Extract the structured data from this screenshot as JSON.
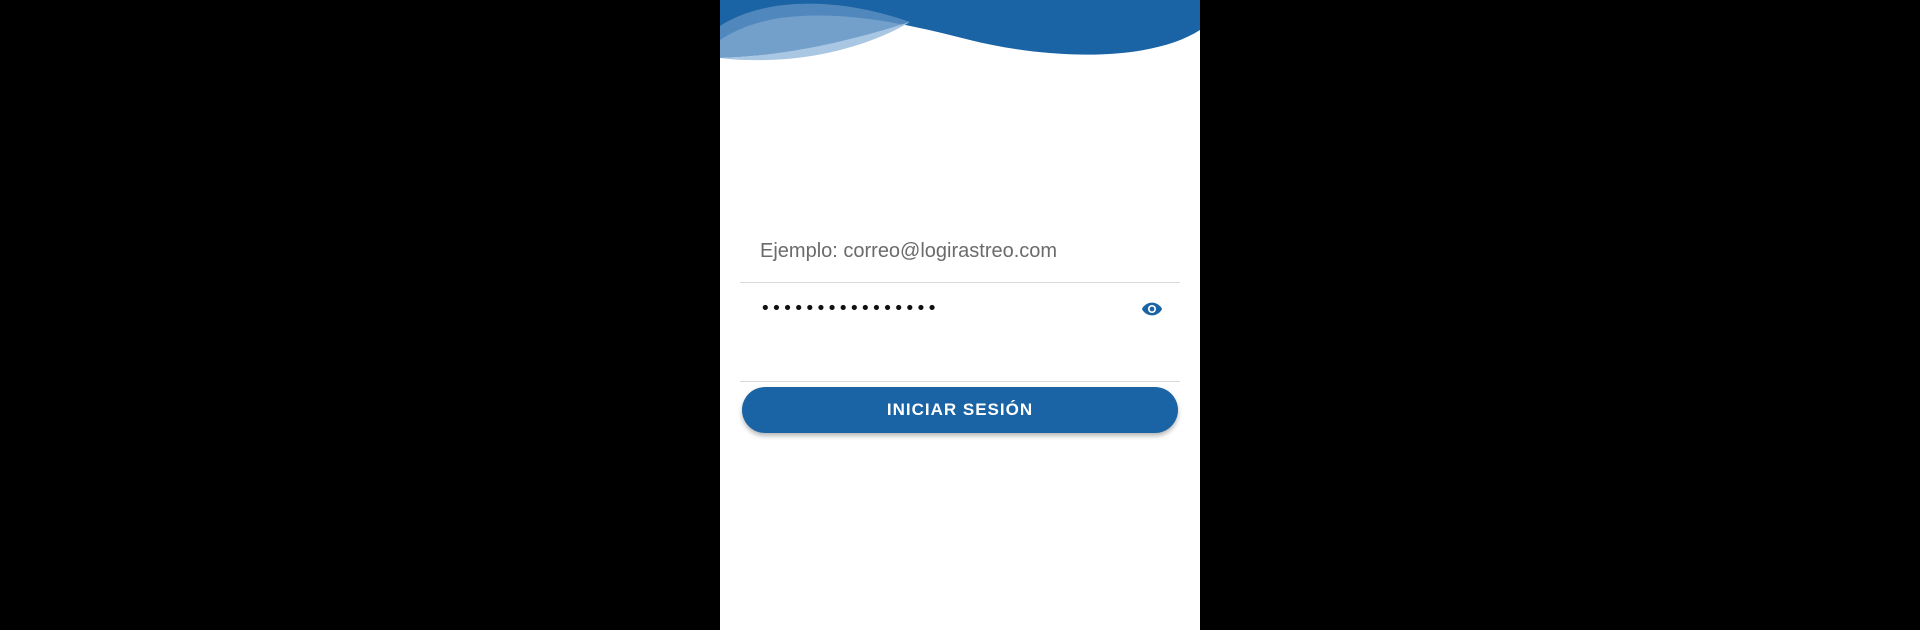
{
  "login": {
    "email_placeholder": "Ejemplo: correo@logirastreo.com",
    "password_masked": "••••••••••••••••",
    "show_password_icon": "eye-icon",
    "submit_label": "INICIAR SESIÓN"
  },
  "theme": {
    "primary": "#1a63a4",
    "wave_light": "#a9c6e2",
    "wave_mid": "#5b8ec2",
    "background": "#ffffff",
    "letterbox": "#000000"
  }
}
